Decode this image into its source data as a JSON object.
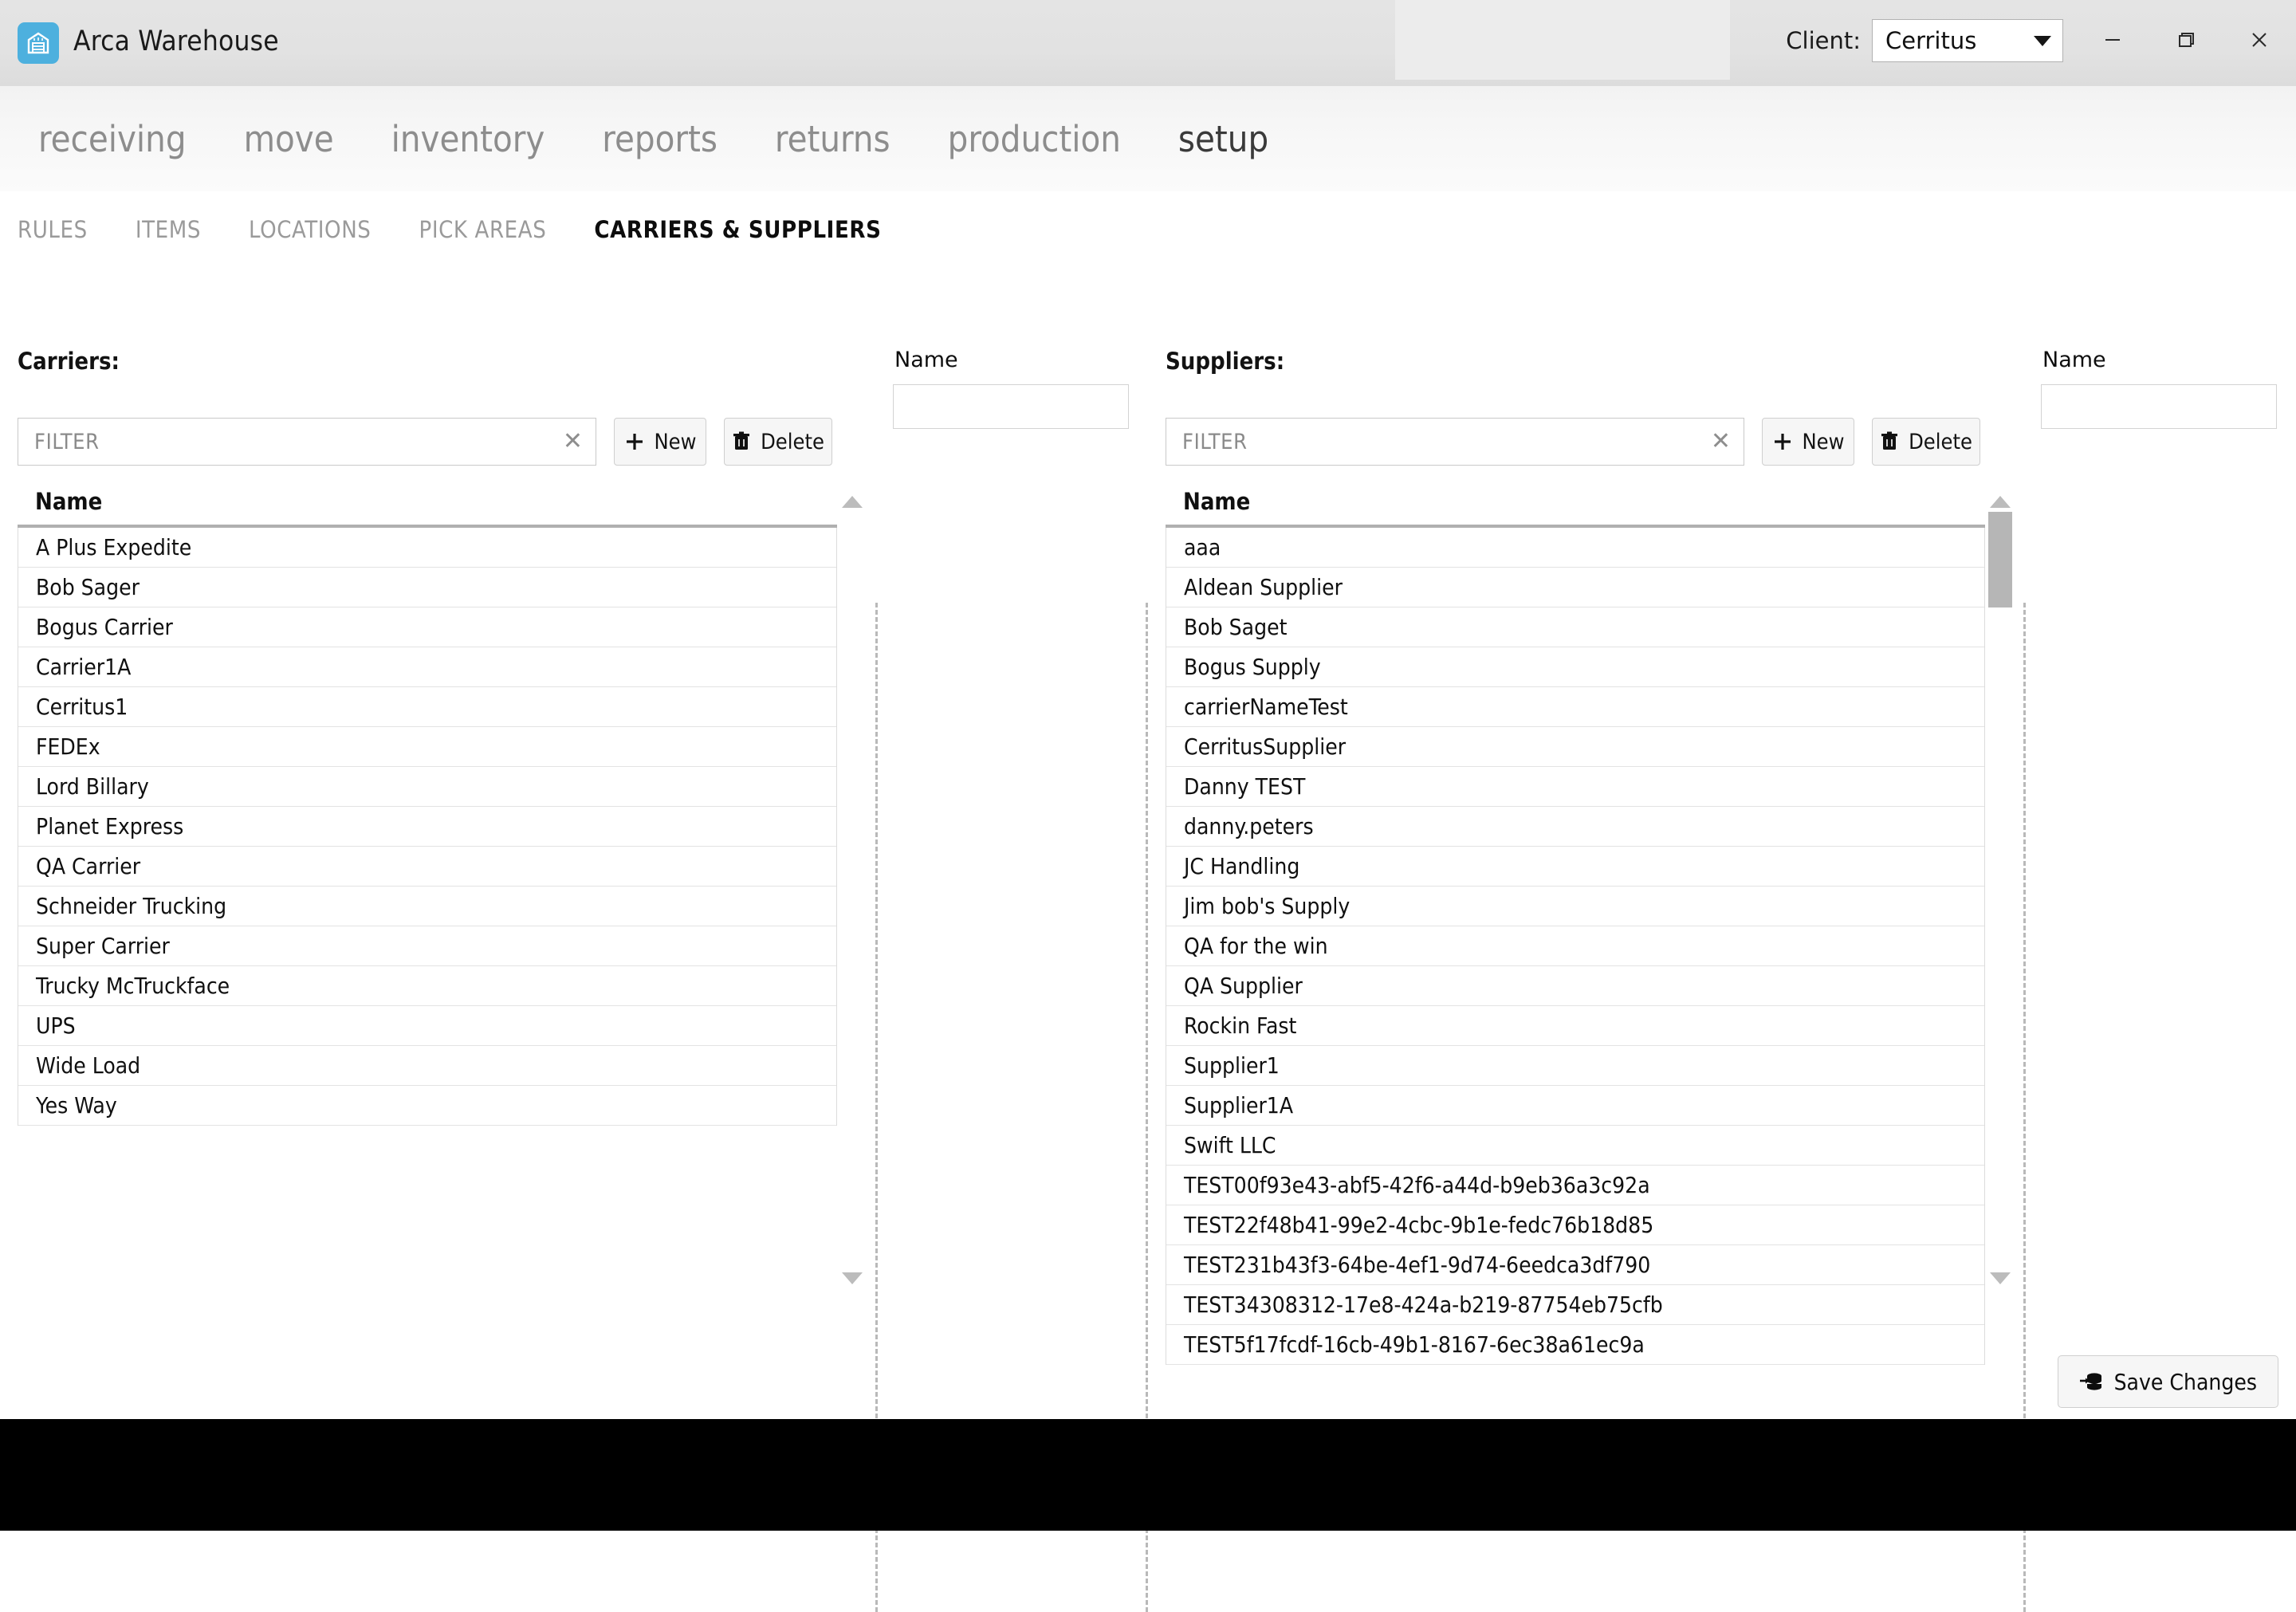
{
  "window": {
    "app_title": "Arca Warehouse",
    "app_icon": "warehouse-icon",
    "client_label": "Client:",
    "client_value": "Cerritus",
    "minimize_icon": "minimize-icon",
    "maximize_icon": "restore-icon",
    "close_icon": "close-icon",
    "accent_color": "#4db0de"
  },
  "main_nav": {
    "items": [
      {
        "label": "receiving",
        "active": false
      },
      {
        "label": "move",
        "active": false
      },
      {
        "label": "inventory",
        "active": false
      },
      {
        "label": "reports",
        "active": false
      },
      {
        "label": "returns",
        "active": false
      },
      {
        "label": "production",
        "active": false
      },
      {
        "label": "setup",
        "active": true
      }
    ]
  },
  "sub_nav": {
    "items": [
      {
        "label": "RULES",
        "active": false
      },
      {
        "label": "ITEMS",
        "active": false
      },
      {
        "label": "LOCATIONS",
        "active": false
      },
      {
        "label": "PICK AREAS",
        "active": false
      },
      {
        "label": "CARRIERS & SUPPLIERS",
        "active": true
      }
    ]
  },
  "carriers": {
    "title": "Carriers:",
    "filter_placeholder": "FILTER",
    "filter_value": "",
    "clear_icon": "clear-x-icon",
    "new_label": "New",
    "new_icon": "plus-icon",
    "delete_label": "Delete",
    "delete_icon": "trash-icon",
    "column_header": "Name",
    "rows": [
      "A Plus Expedite",
      "Bob Sager",
      "Bogus Carrier",
      "Carrier1A",
      "Cerritus1",
      "FEDEx",
      "Lord Billary",
      "Planet Express",
      "QA Carrier",
      "Schneider Trucking",
      "Super Carrier",
      "Trucky McTruckface",
      "UPS",
      "Wide Load",
      "Yes Way"
    ],
    "detail": {
      "name_label": "Name",
      "name_value": ""
    }
  },
  "suppliers": {
    "title": "Suppliers:",
    "filter_placeholder": "FILTER",
    "filter_value": "",
    "clear_icon": "clear-x-icon",
    "new_label": "New",
    "new_icon": "plus-icon",
    "delete_label": "Delete",
    "delete_icon": "trash-icon",
    "column_header": "Name",
    "rows": [
      "aaa",
      "Aldean Supplier",
      "Bob Saget",
      "Bogus Supply",
      "carrierNameTest",
      "CerritusSupplier",
      "Danny TEST",
      "danny.peters",
      "JC Handling",
      "Jim bob's Supply",
      "QA for the win",
      "QA Supplier",
      "Rockin Fast",
      "Supplier1",
      "Supplier1A",
      "Swift LLC",
      "TEST00f93e43-abf5-42f6-a44d-b9eb36a3c92a",
      "TEST22f48b41-99e2-4cbc-9b1e-fedc76b18d85",
      "TEST231b43f3-64be-4ef1-9d74-6eedca3df790",
      "TEST34308312-17e8-424a-b219-87754eb75cfb",
      "TEST5f17fcdf-16cb-49b1-8167-6ec38a61ec9a"
    ],
    "detail": {
      "name_label": "Name",
      "name_value": ""
    }
  },
  "footer": {
    "save_label": "Save Changes",
    "save_icon": "save-database-icon"
  }
}
